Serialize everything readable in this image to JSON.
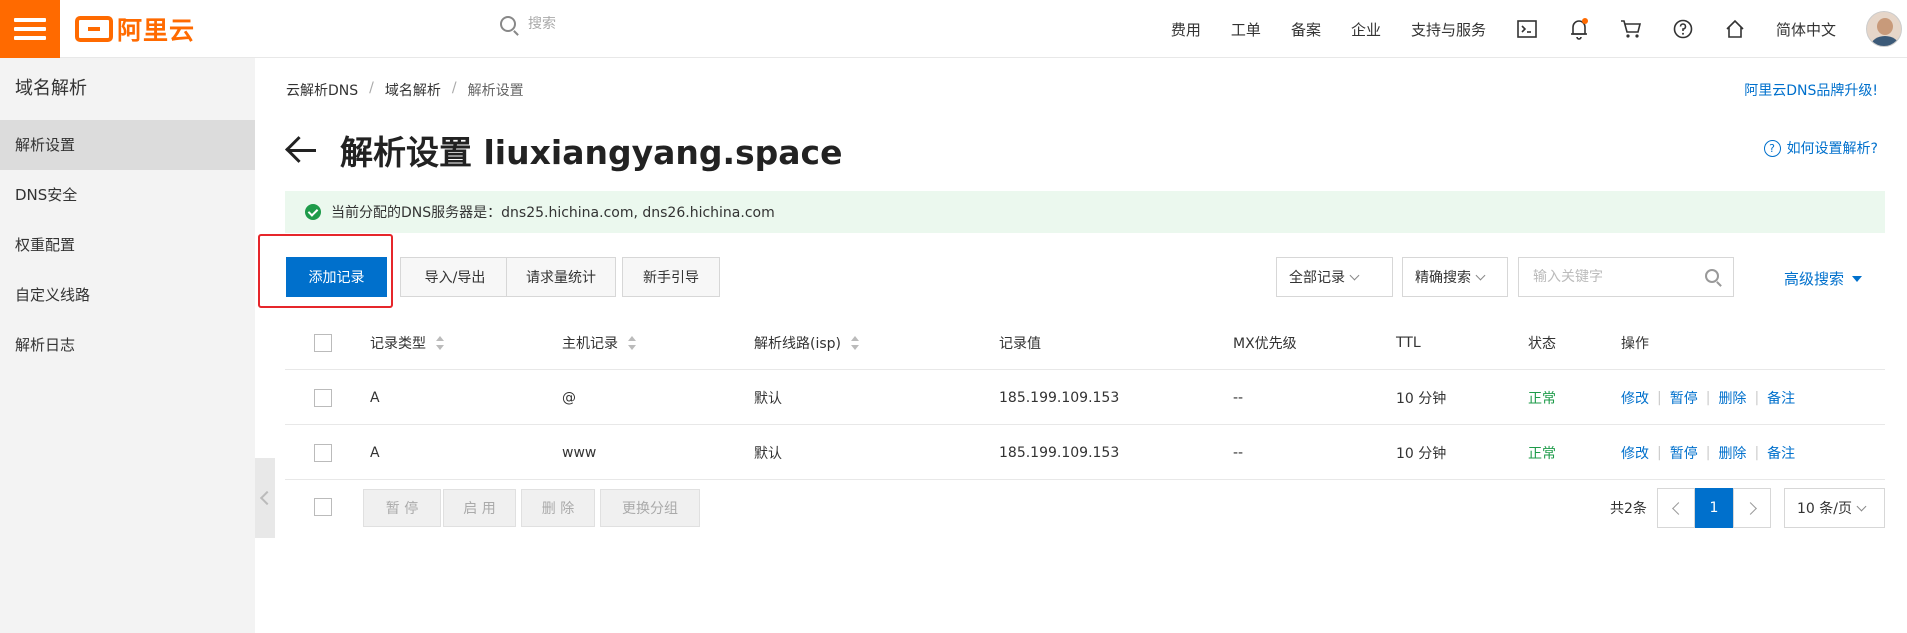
{
  "topbar": {
    "logo_text": "阿里云",
    "search_placeholder": "搜索",
    "nav": [
      "费用",
      "工单",
      "备案",
      "企业",
      "支持与服务"
    ],
    "language": "简体中文",
    "icons": [
      "terminal-icon",
      "bell-icon",
      "cart-icon",
      "help-circle-icon",
      "home-icon"
    ],
    "accent_color": "#ff6a00"
  },
  "sidebar": {
    "title": "域名解析",
    "items": [
      {
        "label": "解析设置",
        "active": true
      },
      {
        "label": "DNS安全",
        "active": false
      },
      {
        "label": "权重配置",
        "active": false
      },
      {
        "label": "自定义线路",
        "active": false
      },
      {
        "label": "解析日志",
        "active": false
      }
    ]
  },
  "breadcrumb": [
    "云解析DNS",
    "域名解析",
    "解析设置"
  ],
  "brand_link": "阿里云DNS品牌升级!",
  "page_title": "解析设置 liuxiangyang.space",
  "help_link": "如何设置解析?",
  "notice": "当前分配的DNS服务器是：dns25.hichina.com, dns26.hichina.com",
  "toolbar": {
    "add_record": "添加记录",
    "import_export": "导入/导出",
    "request_stats": "请求量统计",
    "guide": "新手引导",
    "filter_select": "全部记录",
    "search_mode": "精确搜索",
    "keyword_placeholder": "输入关键字",
    "advanced_search": "高级搜索"
  },
  "table": {
    "headers": [
      "记录类型",
      "主机记录",
      "解析线路(isp)",
      "记录值",
      "MX优先级",
      "TTL",
      "状态",
      "操作"
    ],
    "rows": [
      {
        "type": "A",
        "host": "@",
        "line": "默认",
        "value": "185.199.109.153",
        "mx": "--",
        "ttl": "10 分钟",
        "status": "正常"
      },
      {
        "type": "A",
        "host": "www",
        "line": "默认",
        "value": "185.199.109.153",
        "mx": "--",
        "ttl": "10 分钟",
        "status": "正常"
      }
    ],
    "actions": [
      "修改",
      "暂停",
      "删除",
      "备注"
    ]
  },
  "bulk_actions": [
    "暂 停",
    "启 用",
    "删 除",
    "更换分组"
  ],
  "pagination": {
    "total": "共2条",
    "current": "1",
    "page_size": "10 条/页"
  },
  "colors": {
    "primary": "#0070cc",
    "success": "#1e9b4a",
    "highlight": "#e6262b"
  }
}
